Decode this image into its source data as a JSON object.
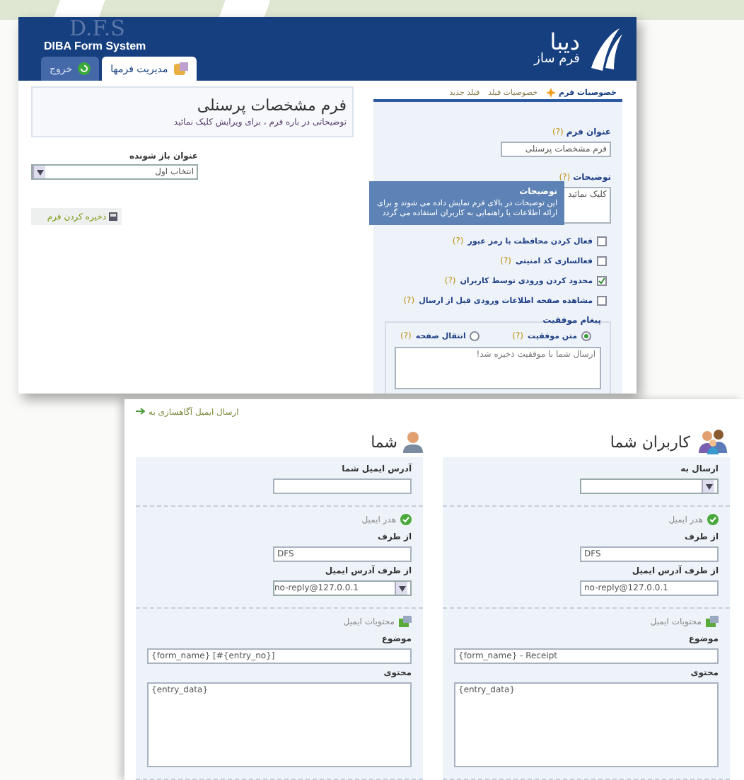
{
  "header": {
    "watermark": "D.F.S",
    "system_name": "DIBA Form System",
    "logo_title": "دیبا",
    "logo_subtitle": "فرم ساز"
  },
  "tabs": [
    {
      "label": "مدیریت فرمها",
      "selected": true,
      "kind": "forms"
    },
    {
      "label": "خروج",
      "selected": false,
      "kind": "exit"
    }
  ],
  "form_preview": {
    "title": "فرم مشخصات پرسنلی",
    "description": "توضیحاتی در باره فرم ، برای ویرایش کلیک نمائید",
    "field": {
      "label": "عنوان باز شونده",
      "value": "انتخاب اول"
    },
    "save_button": "ذخیره کردن فرم"
  },
  "properties": {
    "tabs": [
      {
        "label": "خصوصیات فرم",
        "selected": true
      },
      {
        "label": "خصوصیات فیلد",
        "selected": false
      },
      {
        "label": "فیلد جدید",
        "selected": false
      }
    ],
    "title_field": {
      "label": "عنوان فرم",
      "help": "(?)",
      "value": "فرم مشخصات پرسنلی"
    },
    "description_field": {
      "label": "توضیحات",
      "help": "(?)",
      "value": "کلیک نمائید"
    },
    "tooltip": {
      "title": "توضیحات",
      "text": "این توضیحات در بالای فرم نمایش داده می شوند و برای ارائه اطلاعات یا راهنمایی به کاربران استفاده می گردد"
    },
    "options": [
      {
        "label": "فعال کردن محافظت با رمز عبور",
        "help": "(?)",
        "checked": false
      },
      {
        "label": "فعالسازی کد امنیتی",
        "help": "(?)",
        "checked": false
      },
      {
        "label": "محدود کردن ورودی توسط کاربران",
        "help": "(?)",
        "checked": true
      },
      {
        "label": "مشاهده صفحه اطلاعات ورودی قبل از ارسال",
        "help": "(?)",
        "checked": false
      }
    ],
    "success": {
      "legend": "پیغام موفقیت",
      "options": [
        {
          "label": "متن موفقیت",
          "help": "(?)",
          "selected": true
        },
        {
          "label": "انتقال صفحه",
          "help": "(?)",
          "selected": false
        }
      ],
      "message": "ارسال شما با موفقیت ذخیره شد!"
    }
  },
  "notifications": {
    "heading": "ارسال ایمیل آگاهسازی به",
    "columns": [
      {
        "title": "کاربران شما",
        "kind": "group",
        "sections": [
          {
            "fields": [
              {
                "label": "ارسال به",
                "kind": "select"
              }
            ]
          },
          {
            "heading": "هدر ایمیل",
            "kind": "check",
            "fields": [
              {
                "label": "از طرف",
                "kind": "input",
                "value": "DFS"
              },
              {
                "label": "از طرف آدرس ایمیل",
                "kind": "input",
                "value": "no-reply@127.0.0.1"
              }
            ]
          },
          {
            "heading": "محتویات ایمیل",
            "kind": "mail",
            "fields": [
              {
                "label": "موضوع",
                "kind": "wide",
                "value": "{form_name} - Receipt"
              },
              {
                "label": "محتوی",
                "kind": "textarea",
                "value": "{entry_data}"
              }
            ]
          }
        ]
      },
      {
        "title": "شما",
        "kind": "person",
        "sections": [
          {
            "fields": [
              {
                "label": "آدرس ایمیل شما",
                "kind": "input"
              }
            ]
          },
          {
            "heading": "هدر ایمیل",
            "kind": "check",
            "fields": [
              {
                "label": "از طرف",
                "kind": "input",
                "value": "DFS"
              },
              {
                "label": "از طرف آدرس ایمیل",
                "kind": "select",
                "value": "no-reply@127.0.0.1"
              }
            ]
          },
          {
            "heading": "محتویات ایمیل",
            "kind": "mail",
            "fields": [
              {
                "label": "موضوع",
                "kind": "wide",
                "value": "{form_name} [#{entry_no}]"
              },
              {
                "label": "محتوی",
                "kind": "textarea",
                "value": "{entry_data}"
              }
            ]
          }
        ]
      }
    ]
  }
}
